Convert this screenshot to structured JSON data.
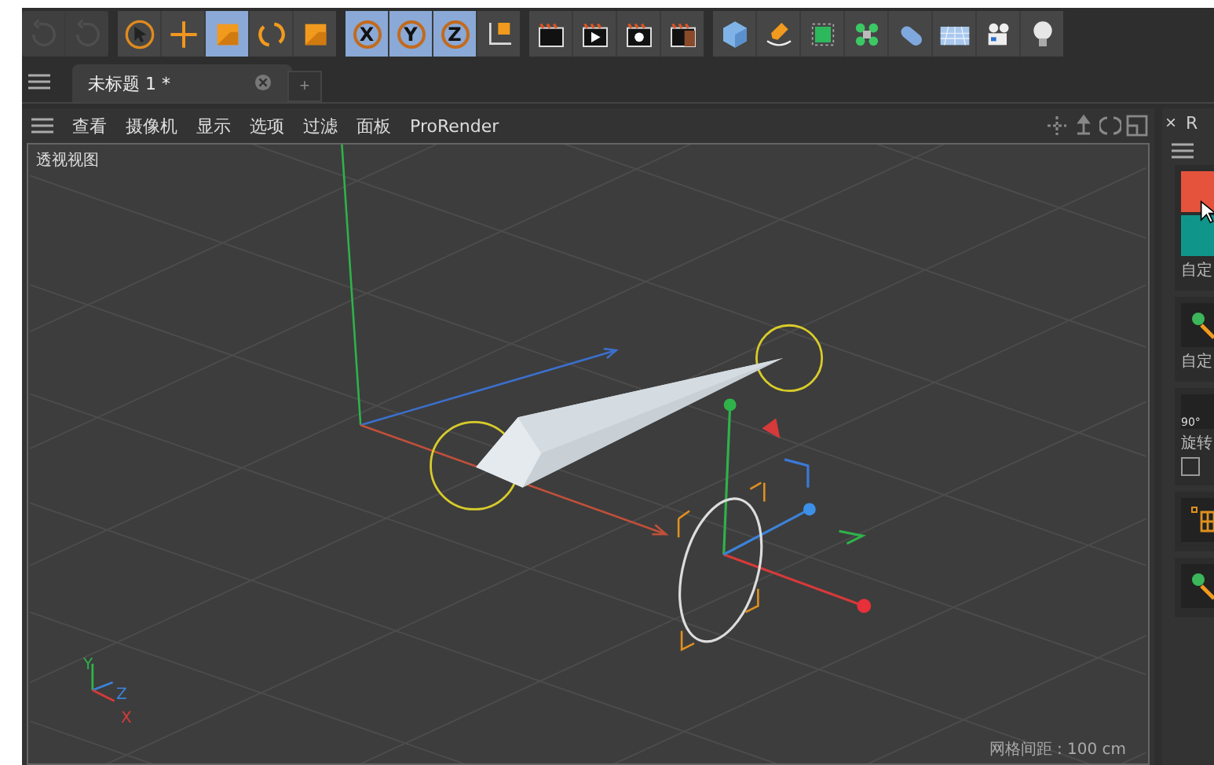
{
  "toolbar": {
    "groups": [
      {
        "tools": [
          {
            "kind": "undo",
            "selected": false
          },
          {
            "kind": "redo",
            "selected": false
          }
        ]
      },
      {
        "tools": [
          {
            "kind": "select",
            "selected": false
          },
          {
            "kind": "move",
            "selected": false
          },
          {
            "kind": "scale",
            "selected": true
          },
          {
            "kind": "rotate",
            "selected": false
          },
          {
            "kind": "recent",
            "selected": false
          }
        ]
      },
      {
        "tools": [
          {
            "kind": "axis",
            "label": "X",
            "selected": true
          },
          {
            "kind": "axis",
            "label": "Y",
            "selected": true
          },
          {
            "kind": "axis",
            "label": "Z",
            "selected": true
          },
          {
            "kind": "coords",
            "selected": false
          }
        ]
      },
      {
        "tools": [
          {
            "kind": "render-region",
            "selected": false
          },
          {
            "kind": "render-view",
            "selected": false
          },
          {
            "kind": "render-settings",
            "selected": false
          },
          {
            "kind": "render-queue",
            "selected": false
          }
        ]
      },
      {
        "tools": [
          {
            "kind": "cube",
            "selected": false
          },
          {
            "kind": "pen",
            "selected": false
          },
          {
            "kind": "subdivision",
            "selected": false
          },
          {
            "kind": "cloner",
            "selected": false
          },
          {
            "kind": "deformer",
            "selected": false
          },
          {
            "kind": "floor",
            "selected": false
          },
          {
            "kind": "camera",
            "selected": false
          },
          {
            "kind": "light",
            "selected": false
          }
        ]
      }
    ]
  },
  "tabs": [
    {
      "label": "未标题 1 *",
      "selected": true
    }
  ],
  "new_tab": "+",
  "viewport": {
    "menu": [
      "查看",
      "摄像机",
      "显示",
      "选项",
      "过滤",
      "面板",
      "ProRender"
    ],
    "view_name": "透视视图",
    "axis_labels": [
      "Y",
      "Z",
      "X"
    ],
    "grid_spacing": "网格间距 : 100 cm"
  },
  "side_panel": {
    "close": "×",
    "title": "R",
    "sections": [
      {
        "kind": "swatches",
        "swatches": [
          {
            "color": "#e5533c"
          },
          {
            "color": "#10958a"
          }
        ],
        "label": "自定"
      },
      {
        "kind": "tool",
        "label": "自定"
      },
      {
        "kind": "angle",
        "badge": "90°",
        "label": "旋转",
        "checked": false
      },
      {
        "kind": "grid"
      },
      {
        "kind": "tool"
      }
    ]
  }
}
